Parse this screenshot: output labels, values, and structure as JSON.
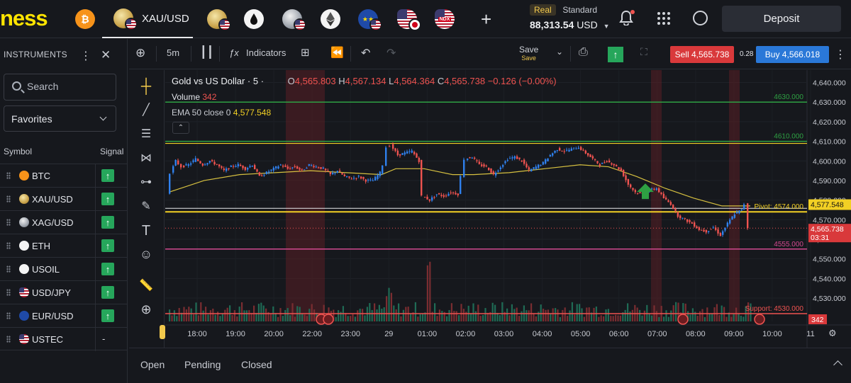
{
  "brand": {
    "logo_text": "ness",
    "accent": "#ffe400"
  },
  "tabs": [
    {
      "id": "btc",
      "label": "",
      "icon": "bitcoin-icon"
    },
    {
      "id": "xauusd",
      "label": "XAU/USD",
      "icon": "gold-usd-icon",
      "active": true
    },
    {
      "id": "xagusd",
      "label": "",
      "icon": "gold-usd-icon"
    },
    {
      "id": "usoil",
      "label": "",
      "icon": "oil-drop-icon"
    },
    {
      "id": "xag",
      "label": "",
      "icon": "silver-usd-icon"
    },
    {
      "id": "eth",
      "label": "",
      "icon": "ethereum-icon"
    },
    {
      "id": "eurusd",
      "label": "",
      "icon": "eu-usd-icon"
    },
    {
      "id": "usdjpy",
      "label": "",
      "icon": "usd-jpy-icon"
    },
    {
      "id": "ustec",
      "label": "",
      "icon": "ndx-icon",
      "badge": "NDX"
    }
  ],
  "account": {
    "mode": "Real",
    "type": "Standard",
    "balance": "88,313.54",
    "currency": "USD"
  },
  "header": {
    "deposit_label": "Deposit"
  },
  "instruments_panel": {
    "title": "INSTRUMENTS",
    "search_placeholder": "Search",
    "list_filter": "Favorites",
    "col_symbol": "Symbol",
    "col_signal": "Signal",
    "items": [
      {
        "symbol": "BTC",
        "signal": "up",
        "icon": "bitcoin-icon"
      },
      {
        "symbol": "XAU/USD",
        "signal": "up",
        "icon": "gold-usd-icon"
      },
      {
        "symbol": "XAG/USD",
        "signal": "up",
        "icon": "silver-usd-icon"
      },
      {
        "symbol": "ETH",
        "signal": "up",
        "icon": "ethereum-icon"
      },
      {
        "symbol": "USOIL",
        "signal": "up",
        "icon": "oil-drop-icon"
      },
      {
        "symbol": "USD/JPY",
        "signal": "up",
        "icon": "usd-jpy-icon"
      },
      {
        "symbol": "EUR/USD",
        "signal": "up",
        "icon": "eu-usd-icon"
      },
      {
        "symbol": "USTEC",
        "signal": "-",
        "icon": "us-flag-icon"
      }
    ]
  },
  "toolbar": {
    "timeframe": "5m",
    "indicators_label": "Indicators",
    "save_label": "Save",
    "save_sub": "Save",
    "sell_label": "Sell 4,565.738",
    "spread": "0.28",
    "buy_label": "Buy 4,566.018"
  },
  "chart_legend": {
    "title": "Gold vs US Dollar · 5 ·",
    "o_label": "O",
    "o": "4,565.803",
    "h_label": "H",
    "h": "4,567.134",
    "l_label": "L",
    "l": "4,564.364",
    "c_label": "C",
    "c": "4,565.738",
    "change": "−0.126 (−0.00%)",
    "volume_label": "Volume",
    "volume": "342",
    "ema_label": "EMA 50 close 0",
    "ema": "4,577.548"
  },
  "chart_data": {
    "type": "candlestick",
    "title": "Gold vs US Dollar · 5 ·",
    "x_ticks": [
      "18:00",
      "19:00",
      "20:00",
      "22:00",
      "23:00",
      "29",
      "01:00",
      "02:00",
      "03:00",
      "04:00",
      "05:00",
      "06:00",
      "07:00",
      "08:00",
      "09:00",
      "10:00",
      "11"
    ],
    "y_ticks": [
      "4,640.000",
      "4,630.000",
      "4,620.000",
      "4,610.000",
      "4,600.000",
      "4,590.000",
      "4,580.000",
      "4,570.000",
      "4,560.000",
      "4,550.000",
      "4,540.000",
      "4,530.000"
    ],
    "ylim": [
      4530,
      4642
    ],
    "horizontal_levels": [
      {
        "label": "4630.000",
        "value": 4630,
        "color": "#2ea043"
      },
      {
        "label": "4610.000",
        "value": 4610,
        "color": "#2ea043"
      },
      {
        "label": "Pivot: 4574.000",
        "value": 4574,
        "color": "#f2d024"
      },
      {
        "label": "4555.000",
        "value": 4555,
        "color": "#d2488f"
      },
      {
        "label": "Support: 4530.000",
        "value": 4530,
        "color": "#ef5350"
      }
    ],
    "ema_label": "4,577.548",
    "last_price": "4,565.738",
    "countdown": "03:31",
    "volume_last": "342",
    "price_path": [
      [
        0,
        4583
      ],
      [
        5,
        4594
      ],
      [
        12,
        4600
      ],
      [
        20,
        4597
      ],
      [
        30,
        4598
      ],
      [
        40,
        4601
      ],
      [
        50,
        4598
      ],
      [
        60,
        4600
      ],
      [
        70,
        4598
      ],
      [
        80,
        4595
      ],
      [
        90,
        4597
      ],
      [
        100,
        4598
      ],
      [
        110,
        4596
      ],
      [
        120,
        4598
      ],
      [
        130,
        4592
      ],
      [
        140,
        4594
      ],
      [
        150,
        4596
      ],
      [
        160,
        4598
      ],
      [
        170,
        4596
      ],
      [
        180,
        4597
      ],
      [
        190,
        4595
      ],
      [
        200,
        4598
      ],
      [
        210,
        4597
      ],
      [
        220,
        4596
      ],
      [
        230,
        4593
      ],
      [
        240,
        4595
      ],
      [
        250,
        4592
      ],
      [
        260,
        4591
      ],
      [
        270,
        4592
      ],
      [
        280,
        4590
      ],
      [
        290,
        4590
      ],
      [
        300,
        4594
      ],
      [
        305,
        4598
      ],
      [
        310,
        4607
      ],
      [
        315,
        4608
      ],
      [
        325,
        4603
      ],
      [
        335,
        4604
      ],
      [
        345,
        4605
      ],
      [
        355,
        4600
      ],
      [
        360,
        4582
      ],
      [
        370,
        4580
      ],
      [
        380,
        4583
      ],
      [
        390,
        4582
      ],
      [
        400,
        4584
      ],
      [
        410,
        4583
      ],
      [
        415,
        4592
      ],
      [
        420,
        4601
      ],
      [
        430,
        4602
      ],
      [
        440,
        4598
      ],
      [
        450,
        4597
      ],
      [
        460,
        4593
      ],
      [
        470,
        4597
      ],
      [
        480,
        4601
      ],
      [
        490,
        4602
      ],
      [
        500,
        4600
      ],
      [
        510,
        4595
      ],
      [
        520,
        4597
      ],
      [
        530,
        4599
      ],
      [
        540,
        4603
      ],
      [
        550,
        4606
      ],
      [
        560,
        4605
      ],
      [
        570,
        4606
      ],
      [
        580,
        4607
      ],
      [
        590,
        4604
      ],
      [
        600,
        4601
      ],
      [
        610,
        4598
      ],
      [
        620,
        4600
      ],
      [
        630,
        4598
      ],
      [
        640,
        4595
      ],
      [
        650,
        4588
      ],
      [
        660,
        4584
      ],
      [
        670,
        4583
      ],
      [
        680,
        4585
      ],
      [
        690,
        4586
      ],
      [
        700,
        4581
      ],
      [
        710,
        4578
      ],
      [
        720,
        4572
      ],
      [
        730,
        4570
      ],
      [
        740,
        4568
      ],
      [
        750,
        4565
      ],
      [
        760,
        4564
      ],
      [
        770,
        4566
      ],
      [
        780,
        4562
      ],
      [
        790,
        4568
      ],
      [
        800,
        4573
      ],
      [
        810,
        4575
      ],
      [
        815,
        4578
      ],
      [
        820,
        4566
      ]
    ],
    "ema_path": [
      [
        0,
        4584
      ],
      [
        50,
        4590
      ],
      [
        100,
        4593
      ],
      [
        150,
        4594
      ],
      [
        200,
        4595
      ],
      [
        250,
        4594
      ],
      [
        300,
        4593
      ],
      [
        320,
        4596
      ],
      [
        360,
        4596
      ],
      [
        400,
        4593
      ],
      [
        430,
        4593
      ],
      [
        480,
        4594
      ],
      [
        530,
        4596
      ],
      [
        580,
        4598
      ],
      [
        620,
        4597
      ],
      [
        660,
        4592
      ],
      [
        700,
        4586
      ],
      [
        740,
        4581
      ],
      [
        780,
        4577
      ],
      [
        820,
        4577
      ]
    ],
    "sessions_shaded": [
      [
        165,
        220
      ],
      [
        680,
        695
      ],
      [
        790,
        805
      ]
    ],
    "signal_arrow_x": 672
  },
  "bottom_tabs": [
    "Open",
    "Pending",
    "Closed"
  ]
}
